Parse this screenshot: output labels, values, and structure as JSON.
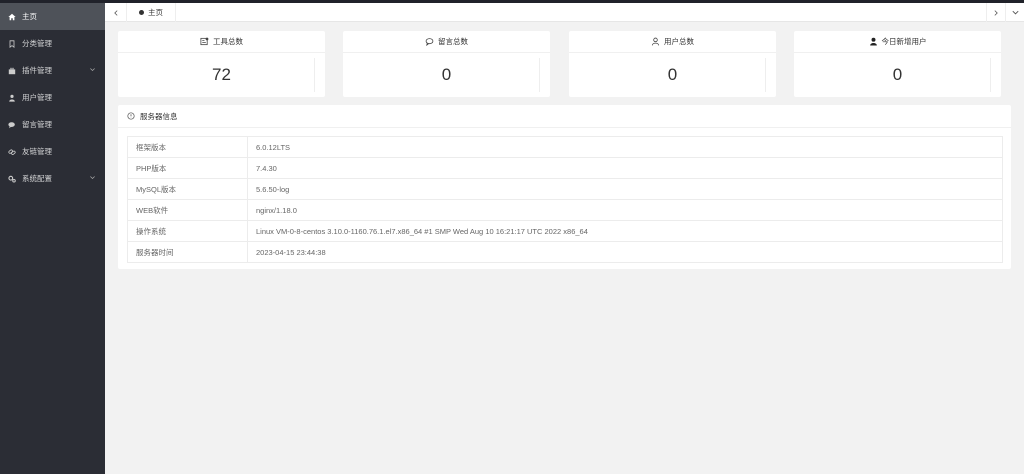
{
  "sidebar": {
    "items": [
      {
        "label": "主页",
        "icon": "home-icon"
      },
      {
        "label": "分类管理",
        "icon": "bookmark-icon"
      },
      {
        "label": "插件管理",
        "icon": "plugin-icon"
      },
      {
        "label": "用户管理",
        "icon": "user-icon"
      },
      {
        "label": "留言管理",
        "icon": "chat-icon"
      },
      {
        "label": "友链管理",
        "icon": "link-icon"
      },
      {
        "label": "系统配置",
        "icon": "gear-icon"
      }
    ]
  },
  "tabs": {
    "home_label": "主页"
  },
  "stats": [
    {
      "title": "工具总数",
      "value": "72",
      "icon": "tool-icon"
    },
    {
      "title": "留言总数",
      "value": "0",
      "icon": "message-icon"
    },
    {
      "title": "用户总数",
      "value": "0",
      "icon": "users-icon"
    },
    {
      "title": "今日新增用户",
      "value": "0",
      "icon": "person-icon"
    }
  ],
  "server": {
    "title": "服务器信息",
    "rows": [
      {
        "key": "框架版本",
        "value": "6.0.12LTS"
      },
      {
        "key": "PHP版本",
        "value": "7.4.30"
      },
      {
        "key": "MySQL版本",
        "value": "5.6.50-log"
      },
      {
        "key": "WEB软件",
        "value": "nginx/1.18.0"
      },
      {
        "key": "操作系统",
        "value": "Linux VM-0-8-centos 3.10.0-1160.76.1.el7.x86_64 #1 SMP Wed Aug 10 16:21:17 UTC 2022 x86_64"
      },
      {
        "key": "服务器时间",
        "value": "2023-04-15 23:44:38"
      }
    ]
  },
  "colors": {
    "sidebar_bg": "#2b2d35",
    "sidebar_active": "#4e5259",
    "page_bg": "#f2f2f2"
  }
}
